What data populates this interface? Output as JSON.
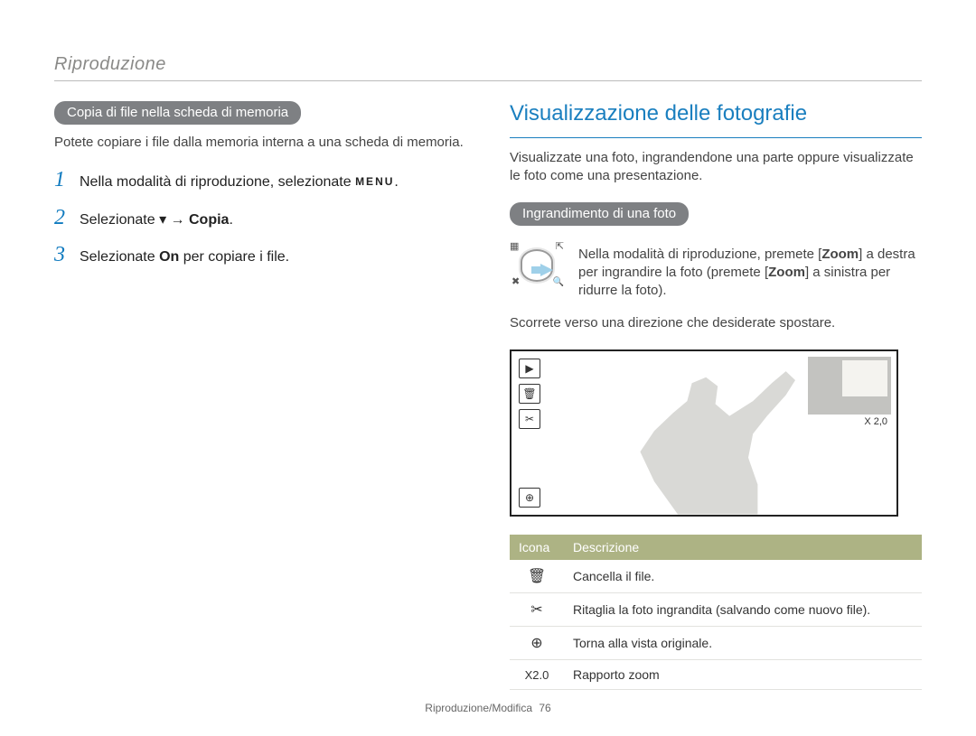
{
  "header": {
    "section": "Riproduzione"
  },
  "left": {
    "pill": "Copia di file nella scheda di memoria",
    "intro": "Potete copiare i file dalla memoria interna a una scheda di memoria.",
    "steps": [
      {
        "num": "1",
        "pre": "Nella modalità di riproduzione, selezionate ",
        "icon": "MENU",
        "post": "."
      },
      {
        "num": "2",
        "pre": "Selezionate ",
        "icon": "▾",
        "arrow": " → ",
        "bold": "Copia",
        "post": "."
      },
      {
        "num": "3",
        "pre": "Selezionate ",
        "bold": "On",
        "post": " per copiare i file."
      }
    ]
  },
  "right": {
    "title": "Visualizzazione delle fotografie",
    "intro": "Visualizzate una foto, ingrandendone una parte oppure visualizzate le foto come una presentazione.",
    "pill": "Ingrandimento di una foto",
    "zoom_instructions_pre": "Nella modalità di riproduzione, premete [",
    "zoom_kw1": "Zoom",
    "zoom_instructions_mid": "] a destra per ingrandire la foto (premete [",
    "zoom_kw2": "Zoom",
    "zoom_instructions_post": "] a sinistra per ridurre la foto).",
    "zoom_widget": {
      "tl": "▦",
      "tr": "⇱",
      "bl": "✖",
      "br": "🔍"
    },
    "scroll_text": "Scorrete verso una direzione che desiderate spostare.",
    "screen": {
      "icons": [
        "▶",
        "🗑",
        "✂",
        "⊕"
      ],
      "zoom_label": "X 2,0"
    },
    "table": {
      "headers": [
        "Icona",
        "Descrizione"
      ],
      "rows": [
        {
          "icon": "🗑",
          "desc": "Cancella il file."
        },
        {
          "icon": "✂",
          "desc": "Ritaglia la foto ingrandita (salvando come nuovo file)."
        },
        {
          "icon": "⊕",
          "desc": "Torna alla vista originale."
        },
        {
          "icon": "X2.0",
          "desc": "Rapporto zoom"
        }
      ]
    }
  },
  "footer": {
    "label": "Riproduzione/Modifica",
    "page": "76"
  }
}
